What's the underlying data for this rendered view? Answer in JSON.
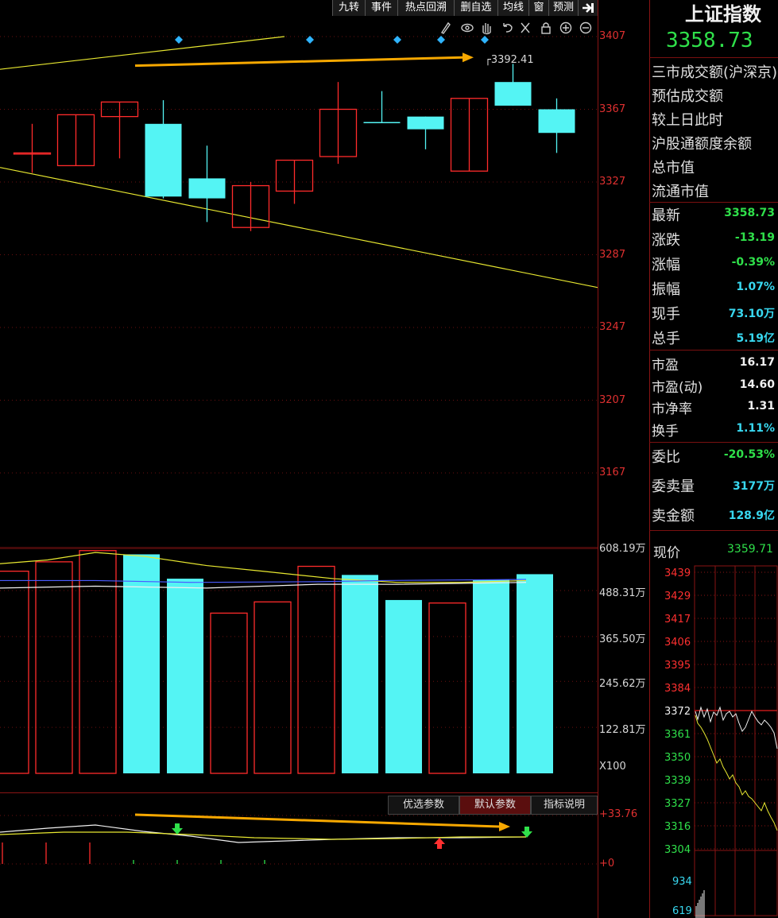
{
  "toolbar": {
    "buttons": [
      "九转",
      "事件",
      "热点回溯",
      "删自选",
      "均线",
      "窗",
      "预测"
    ]
  },
  "main_chart": {
    "price_axis": [
      "3407",
      "3367",
      "3327",
      "3287",
      "3247",
      "3207",
      "3167"
    ],
    "price_range": [
      3127,
      3407
    ],
    "peak_label": "3392.41",
    "candles": [
      {
        "o": 3343,
        "h": 3359,
        "l": 3332,
        "c": 3343,
        "dir": "up"
      },
      {
        "o": 3336,
        "h": 3364,
        "l": 3336,
        "c": 3364,
        "dir": "up"
      },
      {
        "o": 3371,
        "h": 3371,
        "l": 3340,
        "c": 3363,
        "dir": "up"
      },
      {
        "o": 3359,
        "h": 3372,
        "l": 3318,
        "c": 3319,
        "dir": "down"
      },
      {
        "o": 3329,
        "h": 3347,
        "l": 3305,
        "c": 3318,
        "dir": "down"
      },
      {
        "o": 3325,
        "h": 3327,
        "l": 3300,
        "c": 3302,
        "dir": "up"
      },
      {
        "o": 3322,
        "h": 3339,
        "l": 3315,
        "c": 3339,
        "dir": "up"
      },
      {
        "o": 3341,
        "h": 3382,
        "l": 3337,
        "c": 3367,
        "dir": "up"
      },
      {
        "o": 3360,
        "h": 3377,
        "l": 3360,
        "c": 3360,
        "dir": "down"
      },
      {
        "o": 3363,
        "h": 3360,
        "l": 3345,
        "c": 3356,
        "dir": "down"
      },
      {
        "o": 3373,
        "h": 3373,
        "l": 3333,
        "c": 3333,
        "dir": "up"
      },
      {
        "o": 3382,
        "h": 3392,
        "l": 3370,
        "c": 3369,
        "dir": "down"
      },
      {
        "o": 3367,
        "h": 3373,
        "l": 3343,
        "c": 3354,
        "dir": "down"
      }
    ]
  },
  "volume_chart": {
    "axis": [
      "608.19万",
      "488.31万",
      "365.50万",
      "245.62万",
      "122.81万"
    ],
    "multiplier": "X100",
    "max": 608.19,
    "bars": [
      {
        "v": 540,
        "dir": "up"
      },
      {
        "v": 565,
        "dir": "up"
      },
      {
        "v": 595,
        "dir": "up"
      },
      {
        "v": 585,
        "dir": "down"
      },
      {
        "v": 520,
        "dir": "down"
      },
      {
        "v": 428,
        "dir": "up"
      },
      {
        "v": 458,
        "dir": "up"
      },
      {
        "v": 553,
        "dir": "up"
      },
      {
        "v": 530,
        "dir": "down"
      },
      {
        "v": 463,
        "dir": "down"
      },
      {
        "v": 455,
        "dir": "up"
      },
      {
        "v": 518,
        "dir": "down"
      },
      {
        "v": 532,
        "dir": "down"
      }
    ]
  },
  "indicator_panel": {
    "buttons": [
      "优选参数",
      "默认参数",
      "指标说明"
    ],
    "axis": [
      "+33.76",
      "+0"
    ]
  },
  "right_panel": {
    "title": "上证指数",
    "price": "3358.73",
    "labels": [
      "三市成交额(沪深京)",
      "预估成交额",
      "较上日此时",
      "沪股通额度余额",
      "总市值",
      "流通市值"
    ],
    "quotes": [
      {
        "label": "最新",
        "value": "3358.73",
        "color": "green"
      },
      {
        "label": "涨跌",
        "value": "-13.19",
        "color": "green"
      },
      {
        "label": "涨幅",
        "value": "-0.39%",
        "color": "green"
      },
      {
        "label": "振幅",
        "value": "1.07%",
        "color": "cyan"
      },
      {
        "label": "现手",
        "value": "73.10万",
        "color": "cyan"
      },
      {
        "label": "总手",
        "value": "5.19亿",
        "color": "cyan"
      }
    ],
    "valuation": [
      {
        "label": "市盈",
        "value": "16.17"
      },
      {
        "label": "市盈(动)",
        "value": "14.60"
      },
      {
        "label": "市净率",
        "value": "1.31"
      },
      {
        "label": "换手",
        "value": "1.11%",
        "color": "cyan"
      }
    ],
    "orders": [
      {
        "label": "委比",
        "value": "-20.53%",
        "color": "green"
      },
      {
        "label": "委卖量",
        "value": "3177万",
        "color": "cyan"
      },
      {
        "label": "卖金额",
        "value": "128.9亿",
        "color": "cyan"
      }
    ],
    "mini_chart": {
      "label": "现价",
      "value": "3359.71",
      "axis_up": [
        "3439",
        "3429",
        "3417",
        "3406",
        "3395",
        "3384"
      ],
      "axis_mid": "3372",
      "axis_down": [
        "3361",
        "3350",
        "3339",
        "3327",
        "3316",
        "3304"
      ],
      "vol_axis": [
        "934",
        "619"
      ]
    }
  },
  "colors": {
    "up": "#ff2b2b",
    "down": "#54f4f4",
    "grid": "#6a1010",
    "ma_yellow": "#e8e830",
    "ma_white": "#f0f0f0",
    "ma_blue": "#4a5cff",
    "arrow": "#f7a800"
  }
}
